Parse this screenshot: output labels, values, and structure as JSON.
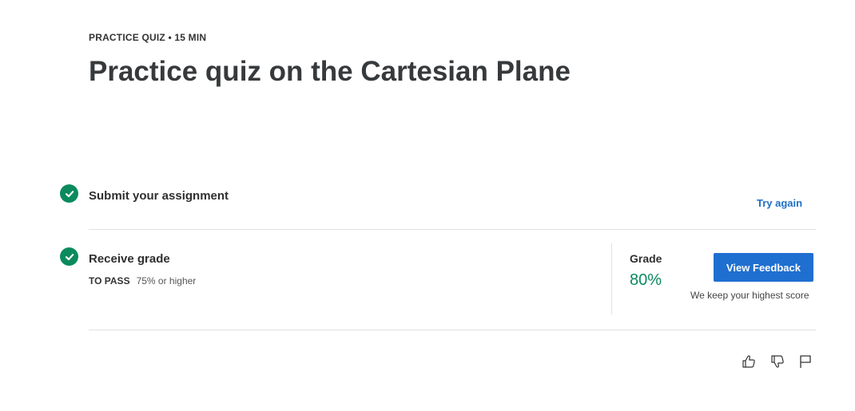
{
  "header": {
    "eyebrow": "PRACTICE QUIZ • 15 MIN",
    "title": "Practice quiz on the Cartesian Plane"
  },
  "steps": [
    {
      "title": "Submit your assignment",
      "status": "complete",
      "action_label": "Try again"
    },
    {
      "title": "Receive grade",
      "status": "complete",
      "pass_label": "TO PASS",
      "pass_value": "75% or higher"
    }
  ],
  "grade": {
    "label": "Grade",
    "value": "80%",
    "button_label": "View Feedback",
    "note": "We keep your highest score"
  },
  "actions": {
    "icons": [
      "thumbs-up-icon",
      "thumbs-down-icon",
      "flag-icon"
    ]
  },
  "colors": {
    "success": "#0b8a5e",
    "link": "#1f6fc5",
    "primary": "#1f6fd0"
  }
}
